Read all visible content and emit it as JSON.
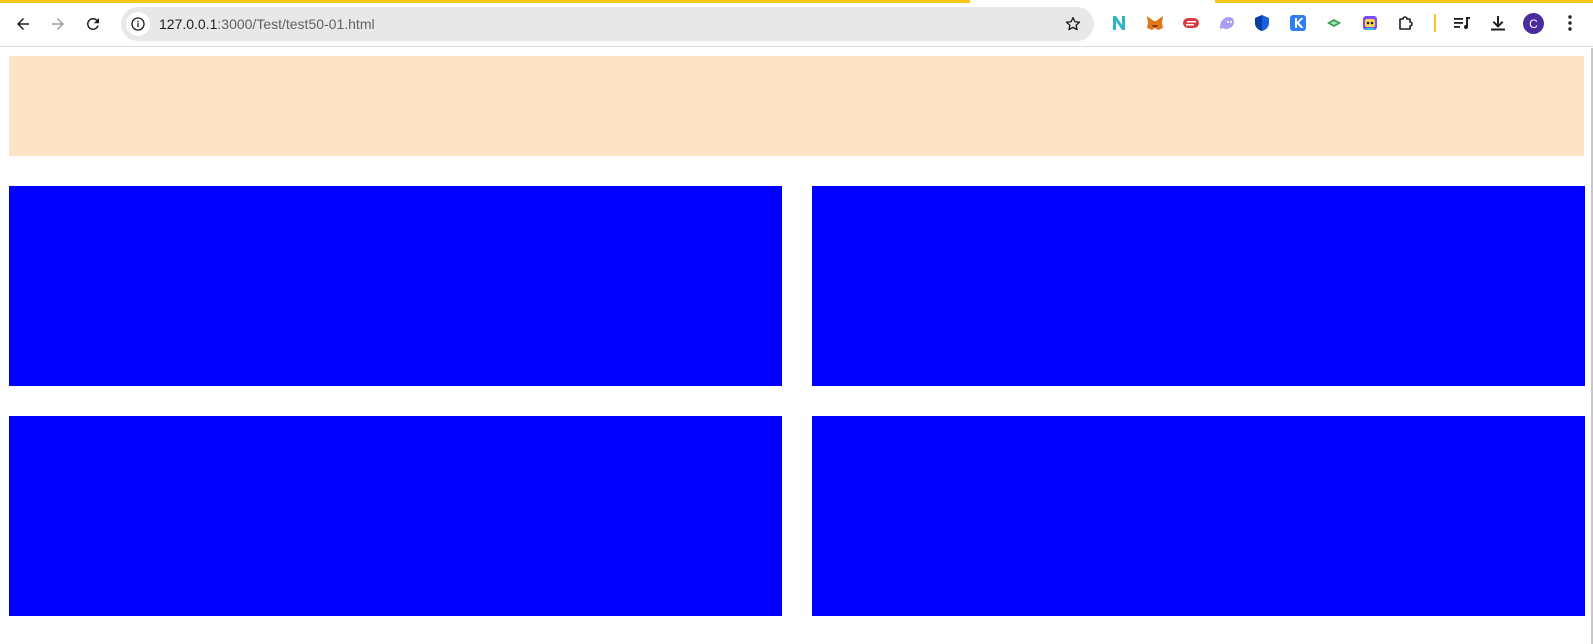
{
  "browser": {
    "url_host": "127.0.0.1",
    "url_rest": ":3000/Test/test50-01.html",
    "profile_initial": "C",
    "extensions": [
      "n-logo-icon",
      "metamask-fox-icon",
      "express-vpn-icon",
      "ghost-icon",
      "shield-icon",
      "k-logo-icon",
      "leaf-icon",
      "robot-icon",
      "puzzle-icon"
    ],
    "colors": {
      "loading_bar": "#f5c518"
    }
  },
  "page": {
    "colors": {
      "banner": "#fde4c4",
      "box": "#0000ff",
      "background": "#ffffff"
    },
    "boxes": [
      "box-1",
      "box-2",
      "box-3",
      "box-4"
    ]
  }
}
